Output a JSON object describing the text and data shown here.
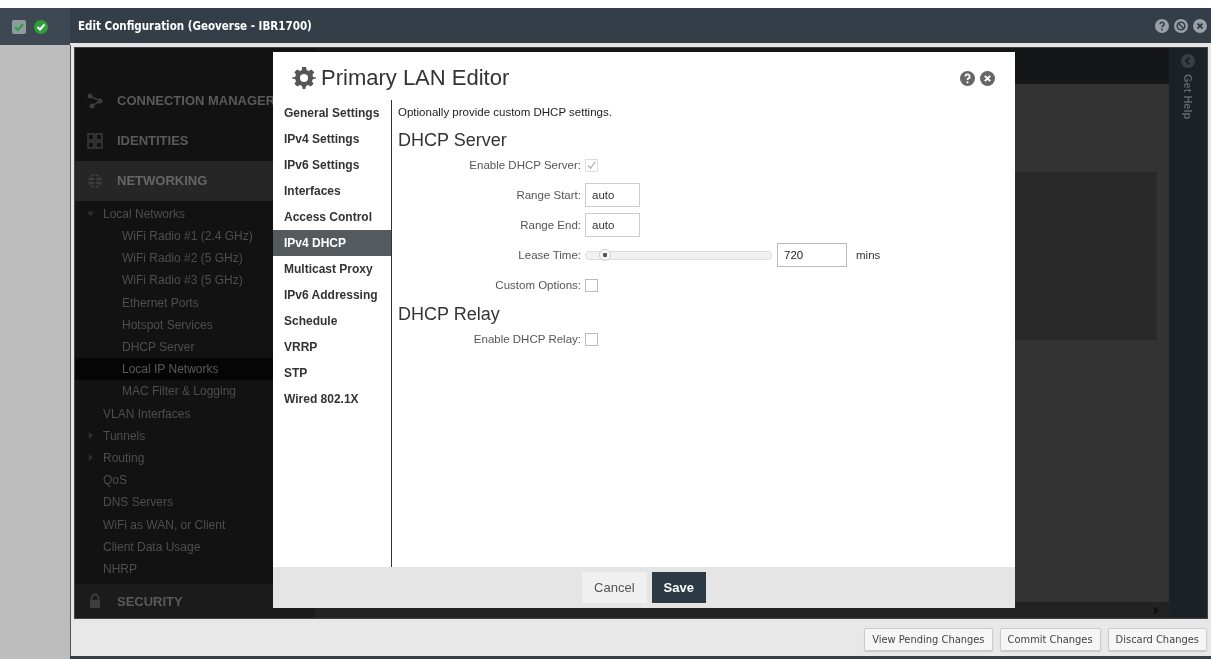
{
  "window": {
    "title": "Edit Configuration (Geoverse - IBR1700)"
  },
  "nav": {
    "sections": [
      {
        "label": "CONNECTION MANAGER",
        "selected": false
      },
      {
        "label": "IDENTITIES",
        "selected": false
      },
      {
        "label": "NETWORKING",
        "selected": true
      }
    ],
    "tree": [
      {
        "label": "Local Networks",
        "expanded": true,
        "selected": false,
        "children": [
          {
            "label": "WiFi Radio #1 (2.4 GHz)",
            "selected": false
          },
          {
            "label": "WiFi Radio #2 (5 GHz)",
            "selected": false
          },
          {
            "label": "WiFi Radio #3 (5 GHz)",
            "selected": false
          },
          {
            "label": "Ethernet Ports",
            "selected": false
          },
          {
            "label": "Hotspot Services",
            "selected": false
          },
          {
            "label": "DHCP Server",
            "selected": false
          },
          {
            "label": "Local IP Networks",
            "selected": true
          },
          {
            "label": "MAC Filter & Logging",
            "selected": false
          }
        ]
      },
      {
        "label": "VLAN Interfaces",
        "selected": false
      },
      {
        "label": "Tunnels",
        "expanded": false,
        "selected": false
      },
      {
        "label": "Routing",
        "expanded": false,
        "selected": false
      },
      {
        "label": "QoS",
        "selected": false
      },
      {
        "label": "DNS Servers",
        "selected": false
      },
      {
        "label": "WiFi as WAN, or Client",
        "selected": false
      },
      {
        "label": "Client Data Usage",
        "selected": false
      },
      {
        "label": "NHRP",
        "selected": false
      }
    ],
    "bottom_section": {
      "label": "SECURITY"
    }
  },
  "get_help": "Get Help",
  "modal": {
    "title": "Primary LAN Editor",
    "tabs": [
      {
        "label": "General Settings",
        "selected": false
      },
      {
        "label": "IPv4 Settings",
        "selected": false
      },
      {
        "label": "IPv6 Settings",
        "selected": false
      },
      {
        "label": "Interfaces",
        "selected": false
      },
      {
        "label": "Access Control",
        "selected": false
      },
      {
        "label": "IPv4 DHCP",
        "selected": true
      },
      {
        "label": "Multicast Proxy",
        "selected": false
      },
      {
        "label": "IPv6 Addressing",
        "selected": false
      },
      {
        "label": "Schedule",
        "selected": false
      },
      {
        "label": "VRRP",
        "selected": false
      },
      {
        "label": "STP",
        "selected": false
      },
      {
        "label": "Wired 802.1X",
        "selected": false
      }
    ],
    "intro": "Optionally provide custom DHCP settings.",
    "sections": [
      {
        "heading": "DHCP Server",
        "fields": [
          {
            "kind": "checkbox",
            "label": "Enable DHCP Server:",
            "checked": true,
            "disabled": true
          },
          {
            "kind": "text",
            "label": "Range Start:",
            "value": "auto"
          },
          {
            "kind": "text",
            "label": "Range End:",
            "value": "auto"
          },
          {
            "kind": "slider",
            "label": "Lease Time:",
            "level": 0.1,
            "value": "720",
            "unit": "mins"
          },
          {
            "kind": "checkbox",
            "label": "Custom Options:",
            "checked": false,
            "disabled": false
          }
        ]
      },
      {
        "heading": "DHCP Relay",
        "fields": [
          {
            "kind": "checkbox",
            "label": "Enable DHCP Relay:",
            "checked": false,
            "disabled": false
          }
        ]
      }
    ],
    "buttons": [
      {
        "label": "Cancel",
        "primary": false
      },
      {
        "label": "Save",
        "primary": true
      }
    ]
  },
  "bottom_bar": {
    "buttons": [
      "View Pending Changes",
      "Commit Changes",
      "Discard Changes"
    ]
  }
}
